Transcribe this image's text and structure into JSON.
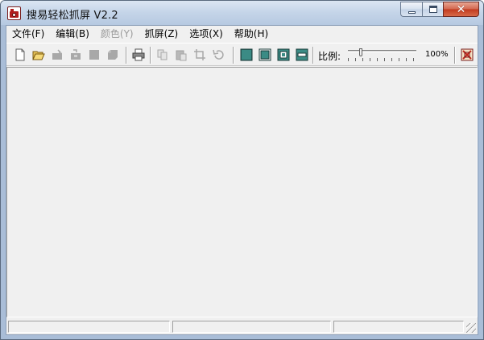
{
  "window": {
    "title": "搜易轻松抓屏 V2.2",
    "close_glyph": "✕"
  },
  "menu": [
    {
      "label": "文件(F)",
      "enabled": true
    },
    {
      "label": "编辑(B)",
      "enabled": true
    },
    {
      "label": "颜色(Y)",
      "enabled": false
    },
    {
      "label": "抓屏(Z)",
      "enabled": true
    },
    {
      "label": "选项(X)",
      "enabled": true
    },
    {
      "label": "帮助(H)",
      "enabled": true
    }
  ],
  "toolbar": {
    "icons": [
      "new-file-icon",
      "open-folder-icon",
      "save-icon",
      "save-as-icon",
      "stop-icon",
      "layers-icon",
      "print-icon",
      "copy-icon",
      "paste-icon",
      "crop-icon",
      "undo-icon",
      "capture-fullscreen-icon",
      "capture-window-icon",
      "capture-region-icon",
      "capture-object-icon",
      "exit-icon"
    ],
    "ratio_label": "比例:",
    "zoom_text": "100%",
    "zoom_percent": 100
  },
  "status": {
    "pane1": "",
    "pane2": "",
    "pane3": ""
  },
  "colors": {
    "capture_button": "#2d6f6a",
    "title_close": "#c1391e"
  }
}
